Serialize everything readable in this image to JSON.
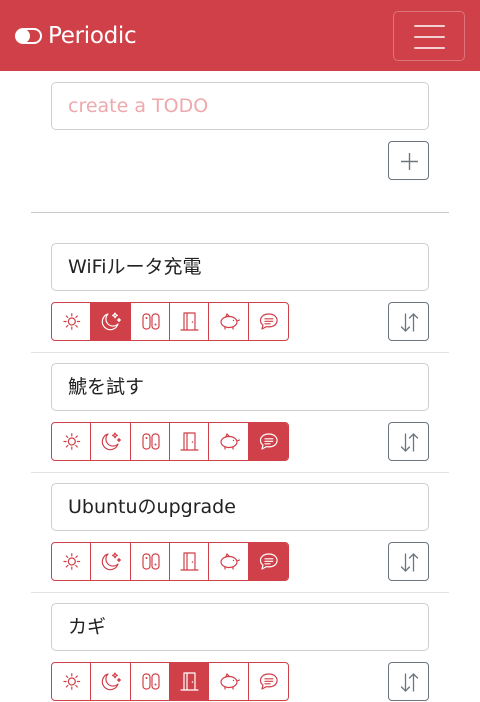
{
  "app": {
    "title": "Periodic",
    "brand_color": "#d04048"
  },
  "navbar": {
    "icons": [
      "toggle-icon",
      "hamburger-icon"
    ]
  },
  "new_todo": {
    "placeholder": "create a TODO",
    "add_icon": "plus-icon"
  },
  "toggles": [
    "sun-icon",
    "moon-stars-icon",
    "nintendo-switch-icon",
    "door-icon",
    "piggy-bank-icon",
    "speech-bubble-icon"
  ],
  "todos": [
    {
      "text": "WiFiルータ充電",
      "active": [
        false,
        true,
        false,
        false,
        false,
        false
      ]
    },
    {
      "text": "鯱を試す",
      "active": [
        false,
        false,
        false,
        false,
        false,
        true
      ]
    },
    {
      "text": "Ubuntuのupgrade",
      "active": [
        false,
        false,
        false,
        false,
        false,
        true
      ]
    },
    {
      "text": "カギ",
      "active": [
        false,
        false,
        false,
        true,
        false,
        false
      ]
    }
  ],
  "sort_icon": "sort-arrows-icon"
}
